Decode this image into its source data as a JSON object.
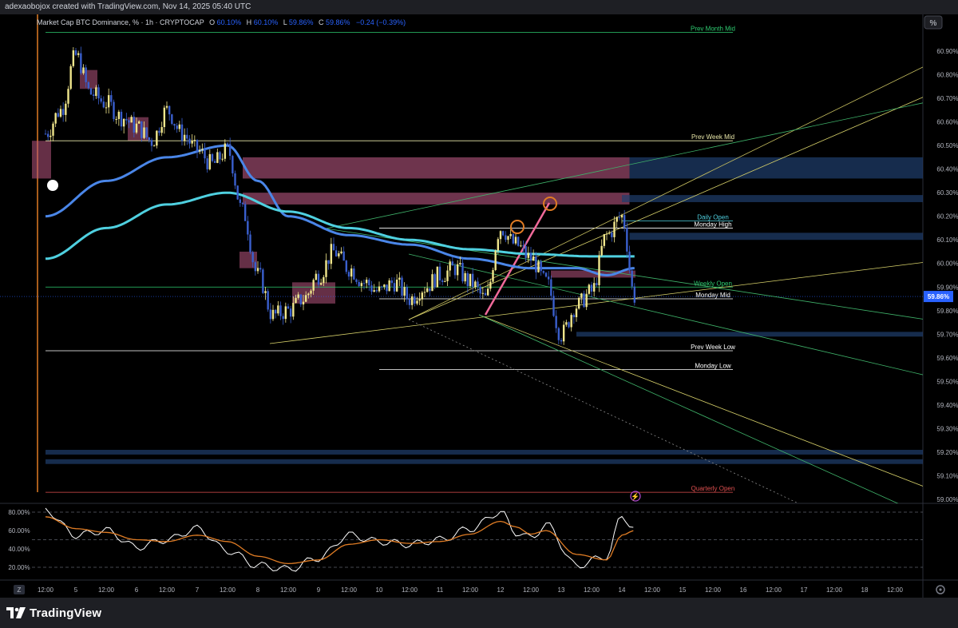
{
  "header": {
    "created_by": "adexaobojox created with TradingView.com, Nov 14, 2025 05:40 UTC"
  },
  "legend": {
    "symbol": "Market Cap BTC Dominance, % · 1h · CRYPTOCAP",
    "open_label": "O",
    "open": "60.10%",
    "high_label": "H",
    "high": "60.10%",
    "low_label": "L",
    "low": "59.86%",
    "close_label": "C",
    "close": "59.86%",
    "change": "−0.24 (−0.39%)"
  },
  "scale_button": "%",
  "footer": {
    "brand": "TradingView",
    "brand_icon": "tradingview-logo-icon"
  },
  "timezone_button": "Z",
  "settings_icon": "gear-icon",
  "alert_icon": "lightning-icon",
  "colors": {
    "background": "#000000",
    "up_candle": "#f0e68c",
    "down_candle": "#3a5fcd",
    "ma_fast": "#4a86e8",
    "ma_slow": "#4fd0e0",
    "supply_zone": "#b85680",
    "demand_zone": "#1f3f6e",
    "rsi_line": "#ffffff",
    "rsi_signal": "#e07c24",
    "current_price": "#2962ff",
    "quarterly_open": "#e05050",
    "prev_month_mid": "#2ecc71"
  },
  "chart_data": [
    {
      "type": "line",
      "subtype": "candlestick",
      "title": "Market Cap BTC Dominance, % · 1h · CRYPTOCAP",
      "y_unit": "%",
      "ylim": [
        59.0,
        61.0
      ],
      "y_ticks": [
        "60.90%",
        "60.80%",
        "60.70%",
        "60.60%",
        "60.50%",
        "60.40%",
        "60.30%",
        "60.20%",
        "60.10%",
        "60.00%",
        "59.90%",
        "59.80%",
        "59.70%",
        "59.60%",
        "59.50%",
        "59.40%",
        "59.30%",
        "59.20%",
        "59.10%",
        "59.00%"
      ],
      "x_ticks": [
        "12:00",
        "5",
        "12:00",
        "6",
        "12:00",
        "7",
        "12:00",
        "8",
        "12:00",
        "9",
        "12:00",
        "10",
        "12:00",
        "11",
        "12:00",
        "12",
        "12:00",
        "13",
        "12:00",
        "14",
        "12:00",
        "15",
        "12:00",
        "16",
        "12:00",
        "17",
        "12:00",
        "18",
        "12:00"
      ],
      "current_price_label": "59.86%",
      "current_price": 59.86,
      "series": [
        {
          "kind": "close",
          "x": [
            "Nov 4 12:00",
            "Nov 4 18:00",
            "Nov 5 00:00",
            "Nov 5 06:00",
            "Nov 5 12:00",
            "Nov 5 18:00",
            "Nov 6 00:00",
            "Nov 6 06:00",
            "Nov 6 12:00",
            "Nov 6 18:00",
            "Nov 7 00:00",
            "Nov 7 06:00",
            "Nov 7 12:00",
            "Nov 7 18:00",
            "Nov 8 00:00",
            "Nov 8 06:00",
            "Nov 8 12:00",
            "Nov 8 18:00",
            "Nov 9 00:00",
            "Nov 9 06:00",
            "Nov 9 12:00",
            "Nov 9 18:00",
            "Nov 10 00:00",
            "Nov 10 06:00",
            "Nov 10 12:00",
            "Nov 10 18:00",
            "Nov 11 00:00",
            "Nov 11 06:00",
            "Nov 11 12:00",
            "Nov 11 18:00",
            "Nov 12 00:00",
            "Nov 12 06:00",
            "Nov 12 12:00",
            "Nov 12 18:00",
            "Nov 13 00:00",
            "Nov 13 06:00",
            "Nov 13 12:00",
            "Nov 13 18:00",
            "Nov 14 00:00",
            "Nov 14 05:00"
          ],
          "values": [
            60.55,
            60.65,
            60.88,
            60.72,
            60.68,
            60.62,
            60.58,
            60.52,
            60.65,
            60.55,
            60.48,
            60.42,
            60.48,
            60.22,
            59.95,
            59.78,
            59.8,
            59.85,
            59.95,
            60.05,
            59.98,
            59.92,
            59.88,
            59.92,
            59.85,
            59.9,
            59.95,
            59.98,
            59.92,
            59.85,
            60.15,
            60.08,
            60.02,
            59.92,
            59.7,
            59.82,
            59.88,
            60.12,
            60.2,
            59.86
          ]
        },
        {
          "kind": "ma",
          "name": "",
          "period_label": "",
          "color_key": "ma_fast",
          "x": [
            "Nov 4 12:00",
            "Nov 5 12:00",
            "Nov 6 12:00",
            "Nov 7 12:00",
            "Nov 8 00:00",
            "Nov 8 12:00",
            "Nov 9 12:00",
            "Nov 10 12:00",
            "Nov 11 12:00",
            "Nov 12 12:00",
            "Nov 13 06:00",
            "Nov 13 18:00",
            "Nov 14 05:00"
          ],
          "values": [
            60.2,
            60.35,
            60.45,
            60.5,
            60.35,
            60.2,
            60.12,
            60.08,
            60.02,
            59.98,
            59.98,
            59.95,
            59.98
          ]
        },
        {
          "kind": "ma",
          "name": "",
          "period_label": "",
          "color_key": "ma_slow",
          "x": [
            "Nov 4 12:00",
            "Nov 5 12:00",
            "Nov 6 12:00",
            "Nov 7 12:00",
            "Nov 8 12:00",
            "Nov 9 12:00",
            "Nov 10 12:00",
            "Nov 11 12:00",
            "Nov 12 12:00",
            "Nov 13 12:00",
            "Nov 14 05:00"
          ],
          "values": [
            60.02,
            60.15,
            60.25,
            60.3,
            60.22,
            60.15,
            60.1,
            60.06,
            60.04,
            60.03,
            60.03
          ]
        }
      ],
      "levels": [
        {
          "label": "Prev Month Mid",
          "value": 60.98,
          "color_key": "prev_month_mid"
        },
        {
          "label": "Prev Week Mid",
          "value": 60.52,
          "color": "#e8e6a8"
        },
        {
          "label": "Daily Open",
          "value": 60.18,
          "color": "#4fd0e0"
        },
        {
          "label": "Monday High",
          "value": 60.15,
          "color": "#ffffff"
        },
        {
          "label": "Weekly Open",
          "value": 59.9,
          "color": "#2ecc71"
        },
        {
          "label": "Monday Mid",
          "value": 59.85,
          "color": "#ffffff"
        },
        {
          "label": "Prev Week Low",
          "value": 59.63,
          "color": "#ffffff"
        },
        {
          "label": "Monday Low",
          "value": 59.55,
          "color": "#ffffff"
        },
        {
          "label": "Quarterly Open",
          "value": 59.03,
          "color_key": "quarterly_open"
        }
      ],
      "zones": [
        {
          "kind": "supply",
          "from": 60.36,
          "to": 60.45,
          "start": "Nov 7 18:00"
        },
        {
          "kind": "supply",
          "from": 60.25,
          "to": 60.3,
          "start": "Nov 7 18:00"
        },
        {
          "kind": "demand",
          "from": 60.36,
          "to": 60.45,
          "start": "Nov 14 03:00"
        },
        {
          "kind": "demand",
          "from": 60.26,
          "to": 60.29,
          "start": "Nov 14 00:00"
        },
        {
          "kind": "demand",
          "from": 60.1,
          "to": 60.13,
          "start": "Nov 14 03:00"
        },
        {
          "kind": "demand",
          "from": 59.69,
          "to": 59.71,
          "start": "Nov 13 06:00"
        },
        {
          "kind": "demand",
          "from": 59.19,
          "to": 59.21,
          "start": "Nov 4 12:00"
        },
        {
          "kind": "demand",
          "from": 59.15,
          "to": 59.17,
          "start": "Nov 4 12:00"
        }
      ]
    },
    {
      "type": "line",
      "subtype": "oscillator",
      "ylim": [
        0,
        100
      ],
      "y_ticks": [
        "80.00%",
        "60.00%",
        "40.00%",
        "20.00%"
      ],
      "reference_lines": [
        80,
        50,
        20
      ],
      "series": [
        {
          "name": "",
          "color_key": "rsi_line",
          "x": [
            "Nov 4 12:00",
            "Nov 5 00:00",
            "Nov 5 12:00",
            "Nov 6 00:00",
            "Nov 6 12:00",
            "Nov 7 00:00",
            "Nov 7 12:00",
            "Nov 8 00:00",
            "Nov 8 12:00",
            "Nov 9 00:00",
            "Nov 9 12:00",
            "Nov 10 00:00",
            "Nov 10 12:00",
            "Nov 11 00:00",
            "Nov 11 12:00",
            "Nov 12 00:00",
            "Nov 12 06:00",
            "Nov 12 12:00",
            "Nov 12 18:00",
            "Nov 13 06:00",
            "Nov 13 18:00",
            "Nov 14 00:00",
            "Nov 14 05:00"
          ],
          "values": [
            82,
            55,
            60,
            42,
            50,
            62,
            38,
            22,
            18,
            30,
            55,
            48,
            45,
            50,
            62,
            80,
            58,
            52,
            66,
            22,
            32,
            76,
            62
          ]
        },
        {
          "name": "",
          "color_key": "rsi_signal",
          "x": [
            "Nov 4 12:00",
            "Nov 5 00:00",
            "Nov 5 12:00",
            "Nov 6 00:00",
            "Nov 6 12:00",
            "Nov 7 00:00",
            "Nov 7 12:00",
            "Nov 8 00:00",
            "Nov 8 12:00",
            "Nov 9 00:00",
            "Nov 9 12:00",
            "Nov 10 00:00",
            "Nov 10 12:00",
            "Nov 11 00:00",
            "Nov 11 12:00",
            "Nov 12 00:00",
            "Nov 12 06:00",
            "Nov 12 12:00",
            "Nov 12 18:00",
            "Nov 13 06:00",
            "Nov 13 18:00",
            "Nov 14 00:00",
            "Nov 14 05:00"
          ],
          "values": [
            75,
            62,
            58,
            50,
            48,
            55,
            48,
            32,
            24,
            28,
            45,
            50,
            46,
            48,
            56,
            70,
            64,
            56,
            60,
            34,
            28,
            55,
            60
          ]
        }
      ]
    }
  ]
}
